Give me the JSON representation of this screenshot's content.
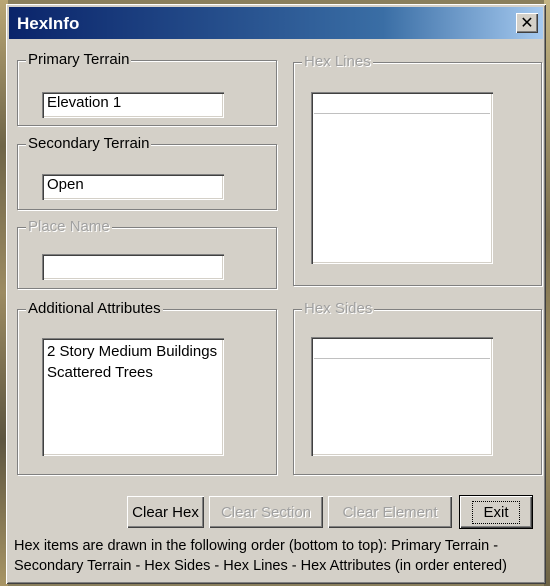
{
  "window": {
    "title": "HexInfo",
    "close_glyph": "✕"
  },
  "primary_terrain": {
    "label": "Primary Terrain",
    "value": "Elevation 1"
  },
  "secondary_terrain": {
    "label": "Secondary Terrain",
    "value": "Open"
  },
  "place_name": {
    "label": "Place Name",
    "value": ""
  },
  "additional_attributes": {
    "label": "Additional Attributes",
    "items": [
      "2 Story Medium Buildings",
      "Scattered Trees"
    ]
  },
  "hex_lines": {
    "label": "Hex Lines"
  },
  "hex_sides": {
    "label": "Hex Sides"
  },
  "buttons": {
    "clear_hex": "Clear Hex",
    "clear_section": "Clear Section",
    "clear_element": "Clear Element",
    "exit": "Exit"
  },
  "footer": {
    "text": "Hex items are drawn in the following order (bottom to top):  Primary Terrain - Secondary Terrain - Hex Sides - Hex Lines - Hex Attributes (in order entered)"
  },
  "colors": {
    "title_gradient_start": "#0a246a",
    "title_gradient_end": "#a6caf0",
    "dialog_face": "#d4d0c8",
    "disabled_text": "#a0a0a0"
  }
}
